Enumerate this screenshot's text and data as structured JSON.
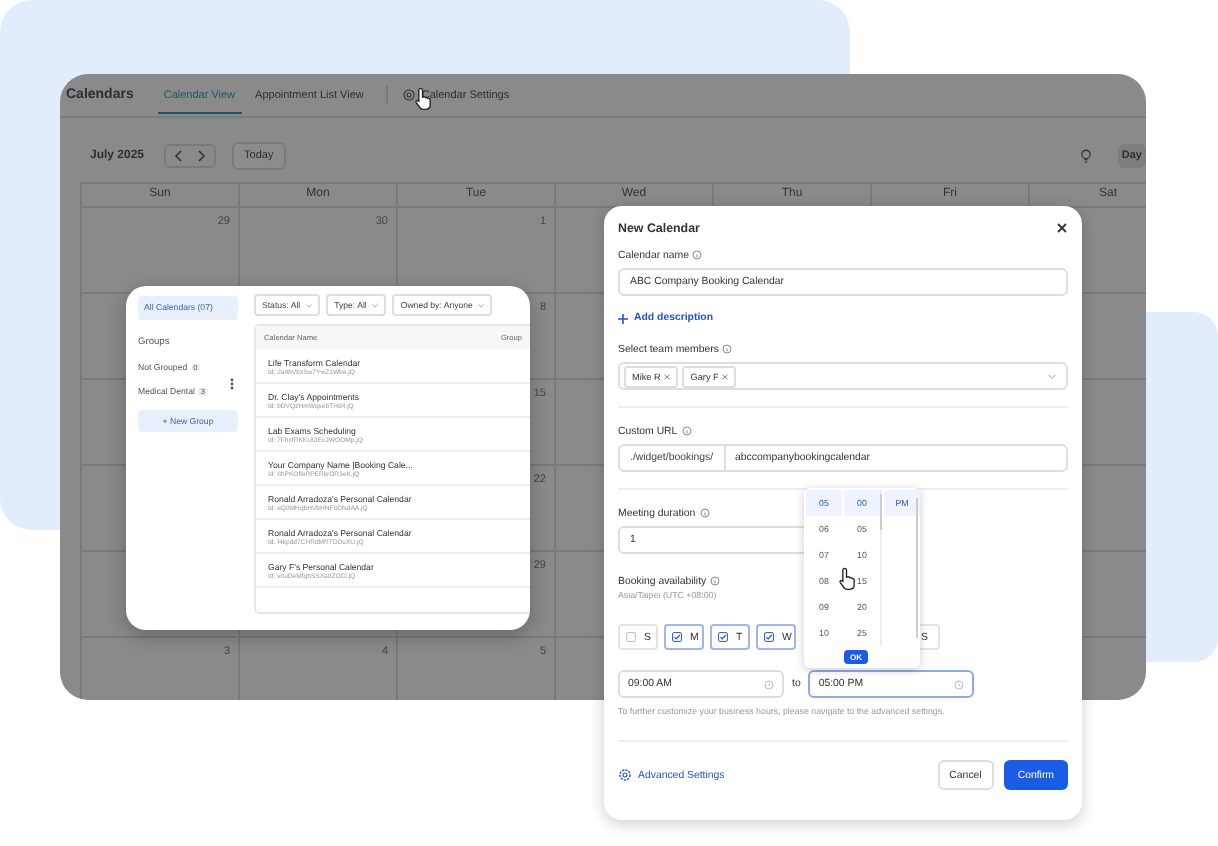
{
  "app": {
    "title": "Calendars",
    "tabs": [
      {
        "label": "Calendar View",
        "selected": true,
        "kind": "plain"
      },
      {
        "label": "Appointment List View",
        "selected": false,
        "kind": "plain"
      },
      {
        "label": "Calendar Settings",
        "selected": false,
        "kind": "settings"
      }
    ],
    "month": "July 2025",
    "today_button": "Today",
    "view_button": "Day",
    "weekdays": [
      "Sun",
      "Mon",
      "Tue",
      "Wed",
      "Thu",
      "Fri",
      "Sat"
    ],
    "weeks": [
      {
        "sun": "29",
        "mon": "30",
        "tue": "1"
      },
      {
        "tue": "8"
      },
      {
        "tue": "15"
      },
      {
        "tue": "22"
      },
      {
        "tue": "29"
      },
      {
        "sun": "3",
        "mon": "4",
        "tue": "5"
      }
    ]
  },
  "calendar_list": {
    "all_item": {
      "label": "All Calendars (07)",
      "selected": true
    },
    "groups_title": "Groups",
    "groups": [
      {
        "name": "Not Grouped",
        "count": "0",
        "selected": false
      },
      {
        "name": "Medical Dental",
        "count": "3",
        "selected": false
      }
    ],
    "new_group_button": "+ New Group",
    "filters": [
      "Status: All",
      "Type: All",
      "Owned by: Anyone"
    ],
    "columns": [
      "Calendar Name",
      "Group"
    ],
    "rows": [
      {
        "name": "Life Transform Calendar",
        "id": "Id: 2a4bVbxSw7YwZ1Wbe.jQ"
      },
      {
        "name": "Dr. Clay's Appointments",
        "id": "Id: bDVQzHmWqsebTHd4.jQ"
      },
      {
        "name": "Lab Exams Scheduling",
        "id": "Id: 7FhxfRKKUt3Ex2WOOMp.jQ"
      },
      {
        "name": "Your Company Name |Booking Cale...",
        "id": "Id: 8hPKOfleRPERkrOR3eK.jQ"
      },
      {
        "name": "Ronald Arradoza's Personal Calendar",
        "id": "Id: eQ8MHqbHVbHNF8DNdAA.jQ"
      },
      {
        "name": "Ronald Arradoza's Personal Calendar",
        "id": "Id: f4kpdd7CHRdMRTDDuXU.jQ"
      },
      {
        "name": "Gary F's Personal Calendar",
        "id": "Id: v8uDeMfqhSSXa8ZOCl.jQ"
      }
    ]
  },
  "new_calendar": {
    "title": "New Calendar",
    "name_label": "Calendar name",
    "name_value": "ABC Company Booking Calendar",
    "add_description": "Add description",
    "members_label": "Select team members",
    "members": [
      "Mike R",
      "Gary F"
    ],
    "url_label": "Custom URL",
    "url_prefix": "./widget/bookings/",
    "url_value": "abccompanybookingcalendar",
    "duration_label": "Meeting duration",
    "duration_value": "1",
    "availability_label": "Booking availability",
    "timezone": "Asia/Taipei (UTC +08:00)",
    "days": [
      {
        "label": "S",
        "checked": false
      },
      {
        "label": "M",
        "checked": true
      },
      {
        "label": "T",
        "checked": true
      },
      {
        "label": "W",
        "checked": true
      },
      {
        "label": "S"
      }
    ],
    "start_time": "09:00 AM",
    "to": "to",
    "end_time": "05:00 PM",
    "end_time_focused": true,
    "hint": "To further customize your business hours, please navigate to the advanced settings.",
    "advanced_settings": "Advanced Settings",
    "cancel": "Cancel",
    "confirm": "Confirm",
    "time_picker": {
      "hours": [
        {
          "label": "05",
          "selected": true
        },
        {
          "label": "06",
          "selected": false
        },
        {
          "label": "07",
          "selected": false
        },
        {
          "label": "08",
          "selected": false
        },
        {
          "label": "09",
          "selected": false
        },
        {
          "label": "10",
          "selected": false
        }
      ],
      "minutes": [
        {
          "label": "00",
          "selected": true
        },
        {
          "label": "05",
          "selected": false
        },
        {
          "label": "10",
          "selected": false
        },
        {
          "label": "15",
          "selected": false
        },
        {
          "label": "20",
          "selected": false
        },
        {
          "label": "25",
          "selected": false
        }
      ],
      "periods": [
        {
          "label": "PM",
          "selected": true
        }
      ],
      "ok": "OK"
    }
  }
}
